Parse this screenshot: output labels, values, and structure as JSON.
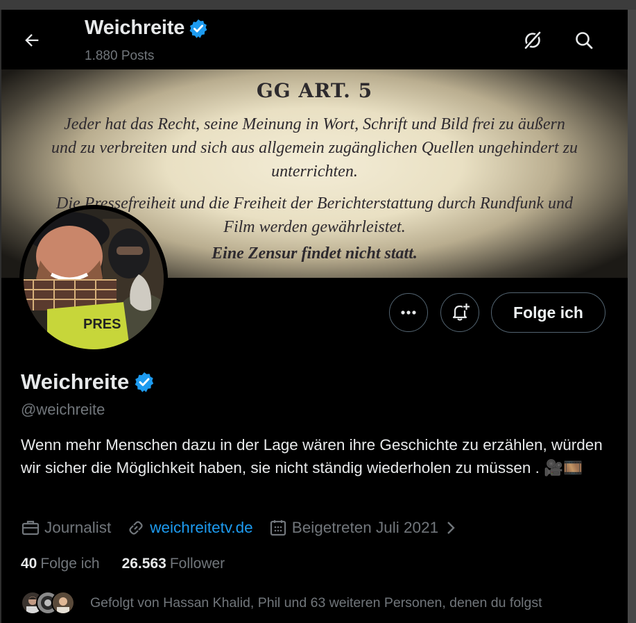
{
  "header": {
    "name": "Weichreite",
    "posts": "1.880 Posts",
    "icons": [
      "arrow-left-icon",
      "verified-badge-icon",
      "grok-icon",
      "search-icon"
    ]
  },
  "banner": {
    "title": "GG ART. 5",
    "lines": [
      "Jeder hat das Recht, seine Meinung in Wort, Schrift und Bild frei zu äußern",
      "und zu verbreiten und sich aus allgemein zugänglichen Quellen ungehindert zu",
      "unterrichten.",
      "Die Pressefreiheit und die Freiheit der Berichterstattung durch Rundfunk und",
      "Film werden gewährleistet.",
      "Eine Zensur findet nicht statt."
    ],
    "avatar_vest_text": "PRES"
  },
  "actions": {
    "more_icon": "more-horizontal-icon",
    "notify_icon": "bell-plus-icon",
    "follow_label": "Folge ich"
  },
  "profile": {
    "name": "Weichreite",
    "handle": "@weichreite",
    "bio": "Wenn mehr Menschen dazu in der Lage wären ihre Geschichte zu erzählen, würden wir sicher die Möglichkeit haben, sie nicht ständig wiederholen zu müssen . 🎥🎞️",
    "category": "Journalist",
    "website": "weichreitetv.de",
    "joined": "Beigetreten Juli 2021",
    "following_count": "40",
    "following_label": "Folge ich",
    "followers_count": "26.563",
    "followers_label": "Follower",
    "followed_by": "Gefolgt von Hassan Khalid, Phil und 63 weiteren Personen, denen du folgst"
  },
  "colors": {
    "background": "#000000",
    "text": "#e7e9ea",
    "secondary": "#71767b",
    "link": "#1d9bf0",
    "verified": "#1d9bf0",
    "border": "#536471"
  }
}
